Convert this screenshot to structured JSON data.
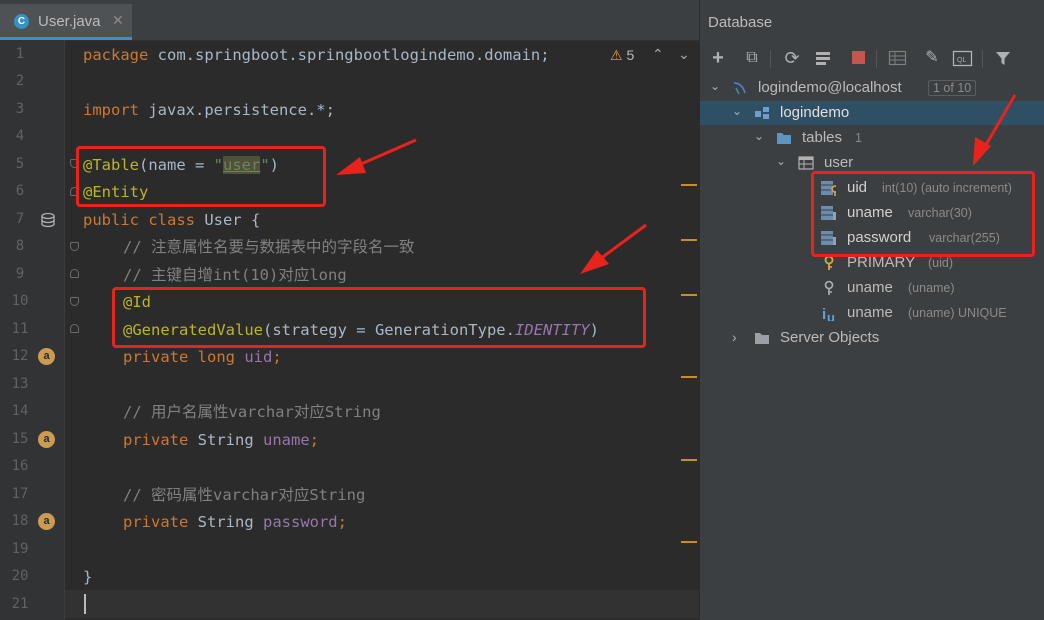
{
  "editor": {
    "tab": {
      "icon_letter": "C",
      "label": "User.java",
      "close": "✕"
    },
    "inspection": {
      "warning_icon": "⚠",
      "count": "5",
      "up": "⌃",
      "down": "⌄"
    },
    "line_numbers": [
      "1",
      "2",
      "3",
      "4",
      "5",
      "6",
      "7",
      "8",
      "9",
      "10",
      "11",
      "12",
      "13",
      "14",
      "15",
      "16",
      "17",
      "18",
      "19",
      "20",
      "21"
    ],
    "gutter_icon_letter": "a",
    "code": {
      "l1_kw": "package",
      "l1_rest": " com.springboot.springbootlogindemo.domain;",
      "l3_kw": "import",
      "l3_rest": " javax.persistence.*;",
      "l5_ann": "@Table",
      "l5_a": "(name = ",
      "l5_q1": "\"",
      "l5_str": "user",
      "l5_q2": "\"",
      "l5_b": ")",
      "l6_ann": "@Entity",
      "l7_kw": "public class",
      "l7_rest": " User {",
      "l8_cmt": "// 注意属性名要与数据表中的字段名一致",
      "l9_cmt": "// 主键自增int(10)对应long",
      "l10_ann": "@Id",
      "l11_ann": "@GeneratedValue",
      "l11_a": "(strategy = GenerationType.",
      "l11_const": "IDENTITY",
      "l11_b": ")",
      "l12_kw": "private long",
      "l12_fld": " uid",
      "l12_end": ";",
      "l14_cmt": "// 用户名属性varchar对应String",
      "l15_kw": "private",
      "l15_type": " String",
      "l15_fld": " uname",
      "l15_end": ";",
      "l17_cmt": "// 密码属性varchar对应String",
      "l18_kw": "private",
      "l18_type": " String",
      "l18_fld": " password",
      "l18_end": ";",
      "l20": "}"
    }
  },
  "database": {
    "title": "Database",
    "toolbar_icons": [
      "add-icon",
      "copy-icon",
      "refresh-icon",
      "schema-icon",
      "stop-icon",
      "table-icon",
      "edit-icon",
      "console-icon",
      "filter-icon"
    ],
    "tree": {
      "datasource": {
        "label": "logindemo@localhost",
        "badge": "1 of 10"
      },
      "schema": {
        "label": "logindemo"
      },
      "tables_folder": {
        "label": "tables",
        "count": "1"
      },
      "table": {
        "label": "user"
      },
      "columns": [
        {
          "name": "uid",
          "type": "int(10) (auto increment)"
        },
        {
          "name": "uname",
          "type": "varchar(30)"
        },
        {
          "name": "password",
          "type": "varchar(255)"
        }
      ],
      "keys": [
        {
          "name": "PRIMARY",
          "detail": "(uid)"
        },
        {
          "name": "uname",
          "detail": "(uname)"
        },
        {
          "name": "uname",
          "detail": "(uname) UNIQUE"
        }
      ],
      "server_objects": {
        "label": "Server Objects"
      }
    }
  },
  "colors": {
    "annotation_box": "#e8231c",
    "keyword": "#cc7832",
    "annotation": "#bbb529",
    "selection": "#2f4f64"
  }
}
